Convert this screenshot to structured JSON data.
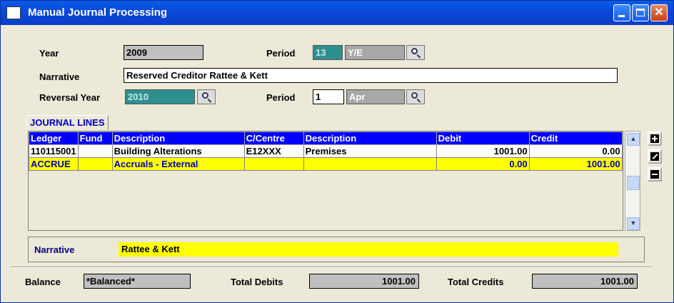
{
  "window": {
    "title": "Manual Journal Processing",
    "controls": [
      "minimize",
      "maximize",
      "close"
    ]
  },
  "header": {
    "year_label": "Year",
    "year_value": "2009",
    "period_label": "Period",
    "period_num": "13",
    "period_desc": "Y/E",
    "narrative_label": "Narrative",
    "narrative_value": "Reserved Creditor Rattee & Kett",
    "reversal_year_label": "Reversal Year",
    "reversal_year_value": "2010",
    "reversal_period_label": "Period",
    "reversal_period_num": "1",
    "reversal_period_desc": "Apr"
  },
  "tab": {
    "label": "JOURNAL LINES"
  },
  "grid": {
    "columns": [
      "Ledger",
      "Fund",
      "Description",
      "C/Centre",
      "Description",
      "Debit",
      "Credit"
    ],
    "rows": [
      {
        "ledger": "110115001",
        "fund": "",
        "description": "Building Alterations",
        "centre": "E12XXX",
        "centre_desc": "Premises",
        "debit": "1001.00",
        "credit": "0.00",
        "selected": false
      },
      {
        "ledger": "ACCRUE",
        "fund": "",
        "description": "Accruals - External",
        "centre": "",
        "centre_desc": "",
        "debit": "0.00",
        "credit": "1001.00",
        "selected": true
      }
    ]
  },
  "line_narrative": {
    "label": "Narrative",
    "value": "Rattee & Kett"
  },
  "footer": {
    "balance_label": "Balance",
    "balance_value": "*Balanced*",
    "total_debits_label": "Total Debits",
    "total_debits_value": "1001.00",
    "total_credits_label": "Total Credits",
    "total_credits_value": "1001.00"
  },
  "side_buttons": [
    "add-line-icon",
    "edit-line-icon",
    "delete-line-icon"
  ]
}
